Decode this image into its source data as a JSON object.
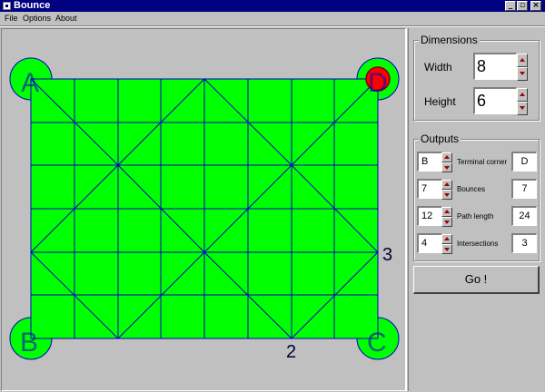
{
  "window": {
    "title": "Bounce",
    "controls": {
      "minimize": "_",
      "maximize": "▫",
      "close": "×"
    }
  },
  "menu": {
    "items": [
      "File",
      "Options",
      "About"
    ]
  },
  "board": {
    "corner_labels": {
      "a": "A",
      "b": "B",
      "c": "C",
      "d": "D"
    },
    "edge_labels": {
      "right": "3",
      "bottom": "2"
    },
    "colors": {
      "field": "#00ff00",
      "grid": "#0000c0",
      "ball": "#ff0000"
    },
    "grid_cols": 8,
    "grid_rows": 6
  },
  "dimensions": {
    "label": "Dimensions",
    "width_label": "Width",
    "width_value": "8",
    "height_label": "Height",
    "height_value": "6"
  },
  "outputs": {
    "label": "Outputs",
    "rows": [
      {
        "guess": "B",
        "label": "Terminal corner",
        "answer": "D"
      },
      {
        "guess": "7",
        "label": "Bounces",
        "answer": "7"
      },
      {
        "guess": "12",
        "label": "Path length",
        "answer": "24"
      },
      {
        "guess": "4",
        "label": "Intersections",
        "answer": "3"
      }
    ]
  },
  "go_button": "Go !"
}
